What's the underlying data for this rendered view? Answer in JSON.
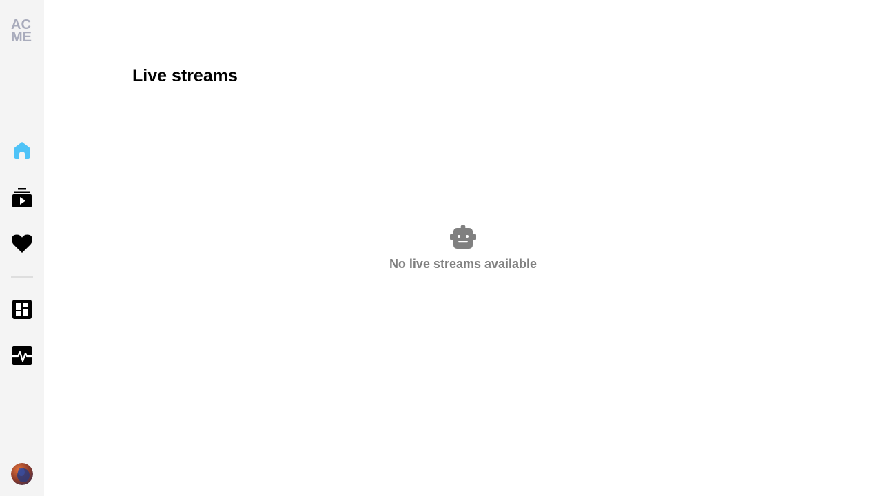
{
  "sidebar": {
    "logo_line1": "AC",
    "logo_line2": "ME",
    "nav": [
      {
        "icon": "home-icon",
        "active": true
      },
      {
        "icon": "subscriptions-icon",
        "active": false
      },
      {
        "icon": "heart-icon",
        "active": false
      },
      {
        "icon": "dashboard-icon",
        "active": false
      },
      {
        "icon": "activity-icon",
        "active": false
      }
    ]
  },
  "main": {
    "title": "Live streams",
    "empty_state": {
      "icon": "robot-icon",
      "message": "No live streams available"
    }
  },
  "colors": {
    "active_nav": "#4fc3f7",
    "sidebar_bg": "#f4f4f4",
    "logo": "#a9acbc",
    "muted_text": "#808080"
  }
}
